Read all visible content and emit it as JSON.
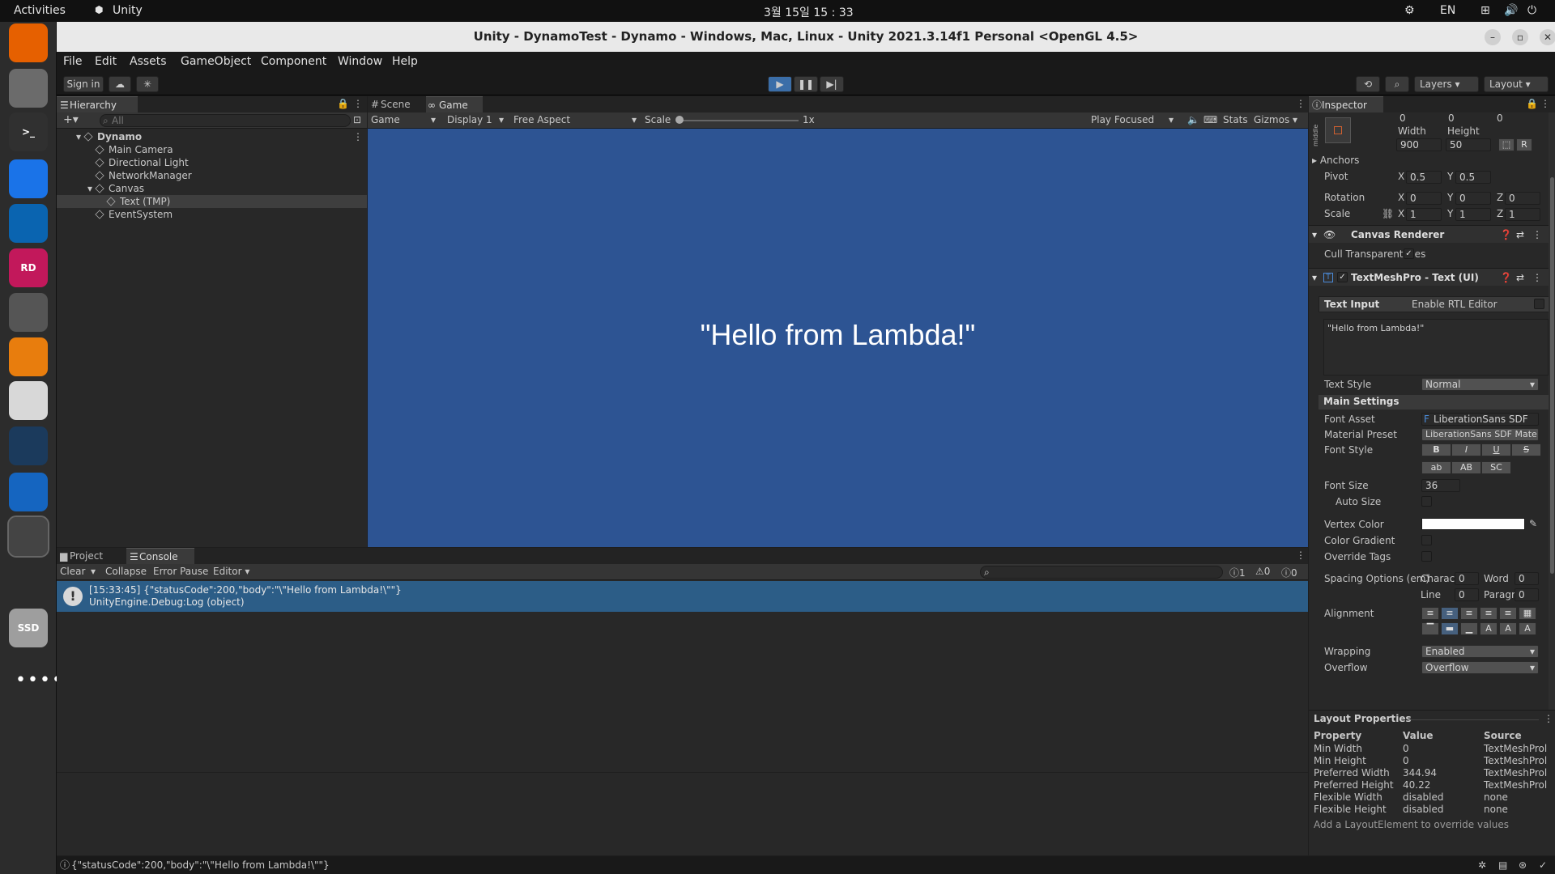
{
  "topbar": {
    "activities": "Activities",
    "app": "Unity",
    "clock": "3월 15일  15 : 33",
    "lang": "EN"
  },
  "dock": [
    {
      "name": "firefox-icon",
      "label": "",
      "bg": "#e66000"
    },
    {
      "name": "files-icon",
      "label": "",
      "bg": "#6b6b6b"
    },
    {
      "name": "terminal-icon",
      "label": ">_",
      "bg": "#303030"
    },
    {
      "name": "chrome-icon",
      "label": "",
      "bg": "#1a73e8"
    },
    {
      "name": "vscode-icon",
      "label": "",
      "bg": "#0a64b0"
    },
    {
      "name": "rider-icon",
      "label": "RD",
      "bg": "#c2185b"
    },
    {
      "name": "unity-hub-icon",
      "label": "",
      "bg": "#555555"
    },
    {
      "name": "blender-icon",
      "label": "",
      "bg": "#e87d0d"
    },
    {
      "name": "document-viewer-icon",
      "label": "",
      "bg": "#d8d8d8"
    },
    {
      "name": "steam-icon",
      "label": "",
      "bg": "#1b3a5c"
    },
    {
      "name": "writer-icon",
      "label": "",
      "bg": "#1565c0"
    },
    {
      "name": "unity-icon",
      "label": "",
      "bg": "#444444"
    },
    {
      "name": "jetbrains-icon",
      "label": "",
      "bg": "#2c2c2c"
    },
    {
      "name": "ssd-icon",
      "label": "SSD",
      "bg": "#9e9e9e"
    }
  ],
  "window": {
    "title": "Unity - DynamoTest - Dynamo - Windows, Mac, Linux - Unity 2021.3.14f1 Personal <OpenGL 4.5>"
  },
  "menu": [
    "File",
    "Edit",
    "Assets",
    "GameObject",
    "Component",
    "Window",
    "Help"
  ],
  "toolbar": {
    "sign_in": "Sign in",
    "layers": "Layers",
    "layout": "Layout"
  },
  "hierarchy": {
    "tab": "Hierarchy",
    "search_placeholder": "All",
    "items": [
      {
        "label": "Dynamo",
        "indent": 0,
        "expanded": true,
        "bold": true
      },
      {
        "label": "Main Camera",
        "indent": 1
      },
      {
        "label": "Directional Light",
        "indent": 1
      },
      {
        "label": "NetworkManager",
        "indent": 1
      },
      {
        "label": "Canvas",
        "indent": 1,
        "expanded": true
      },
      {
        "label": "Text (TMP)",
        "indent": 2,
        "selected": true
      },
      {
        "label": "EventSystem",
        "indent": 1
      }
    ]
  },
  "game": {
    "tab_scene": "Scene",
    "tab_game": "Game",
    "mode": "Game",
    "display": "Display 1",
    "aspect": "Free Aspect",
    "scale_label": "Scale",
    "scale_value": "1x",
    "play_focused": "Play Focused",
    "stats": "Stats",
    "gizmos": "Gizmos",
    "text": "\"Hello from Lambda!\"",
    "bg": "#2d5493"
  },
  "console": {
    "tab_project": "Project",
    "tab_console": "Console",
    "clear": "Clear",
    "collapse": "Collapse",
    "error_pause": "Error Pause",
    "editor": "Editor",
    "count_log": "1",
    "count_warn": "0",
    "count_err": "0",
    "entry_line1": "[15:33:45] {\"statusCode\":200,\"body\":\"\\\"Hello from Lambda!\\\"\"}",
    "entry_line2": "UnityEngine.Debug:Log (object)",
    "status": "{\"statusCode\":200,\"body\":\"\\\"Hello from Lambda!\\\"\"}"
  },
  "inspector": {
    "tab": "Inspector",
    "middle": "middle",
    "pos_x": "0",
    "pos_y": "0",
    "pos_z": "0",
    "width_label": "Width",
    "height_label": "Height",
    "width": "900",
    "height": "50",
    "anchors": "Anchors",
    "pivot": "Pivot",
    "pivot_x": "0.5",
    "pivot_y": "0.5",
    "rotation": "Rotation",
    "rot_x": "0",
    "rot_y": "0",
    "rot_z": "0",
    "scale": "Scale",
    "scale_x": "1",
    "scale_y": "1",
    "scale_z": "1",
    "canvas_renderer": "Canvas Renderer",
    "cull": "Cull Transparent Mes",
    "tmp_title": "TextMeshPro - Text (UI)",
    "text_input": "Text Input",
    "rtl": "Enable RTL Editor",
    "text_value": "\"Hello from Lambda!\"",
    "text_style_label": "Text Style",
    "text_style": "Normal",
    "main_settings": "Main Settings",
    "font_asset_label": "Font Asset",
    "font_asset": "LiberationSans SDF",
    "material_label": "Material Preset",
    "material": "LiberationSans SDF Mate",
    "font_style_label": "Font Style",
    "fs_b": "B",
    "fs_i": "I",
    "fs_u": "U",
    "fs_s": "S",
    "fs_ab": "ab",
    "fs_AB": "AB",
    "fs_sc": "SC",
    "font_size_label": "Font Size",
    "font_size": "36",
    "auto_size": "Auto Size",
    "vertex_color": "Vertex Color",
    "color_gradient": "Color Gradient",
    "override_tags": "Override Tags",
    "spacing": "Spacing Options (em)",
    "charac": "Charac",
    "charac_v": "0",
    "word": "Word",
    "word_v": "0",
    "line": "Line",
    "line_v": "0",
    "paragr": "Paragr",
    "paragr_v": "0",
    "alignment": "Alignment",
    "wrapping_label": "Wrapping",
    "wrapping": "Enabled",
    "overflow_label": "Overflow",
    "overflow": "Overflow"
  },
  "layout_props": {
    "title": "Layout Properties",
    "h_property": "Property",
    "h_value": "Value",
    "h_source": "Source",
    "rows": [
      {
        "p": "Min Width",
        "v": "0",
        "s": "TextMeshProl"
      },
      {
        "p": "Min Height",
        "v": "0",
        "s": "TextMeshProl"
      },
      {
        "p": "Preferred Width",
        "v": "344.94",
        "s": "TextMeshProl"
      },
      {
        "p": "Preferred Height",
        "v": "40.22",
        "s": "TextMeshProl"
      },
      {
        "p": "Flexible Width",
        "v": "disabled",
        "s": "none"
      },
      {
        "p": "Flexible Height",
        "v": "disabled",
        "s": "none"
      }
    ],
    "footer": "Add a LayoutElement to override values"
  }
}
